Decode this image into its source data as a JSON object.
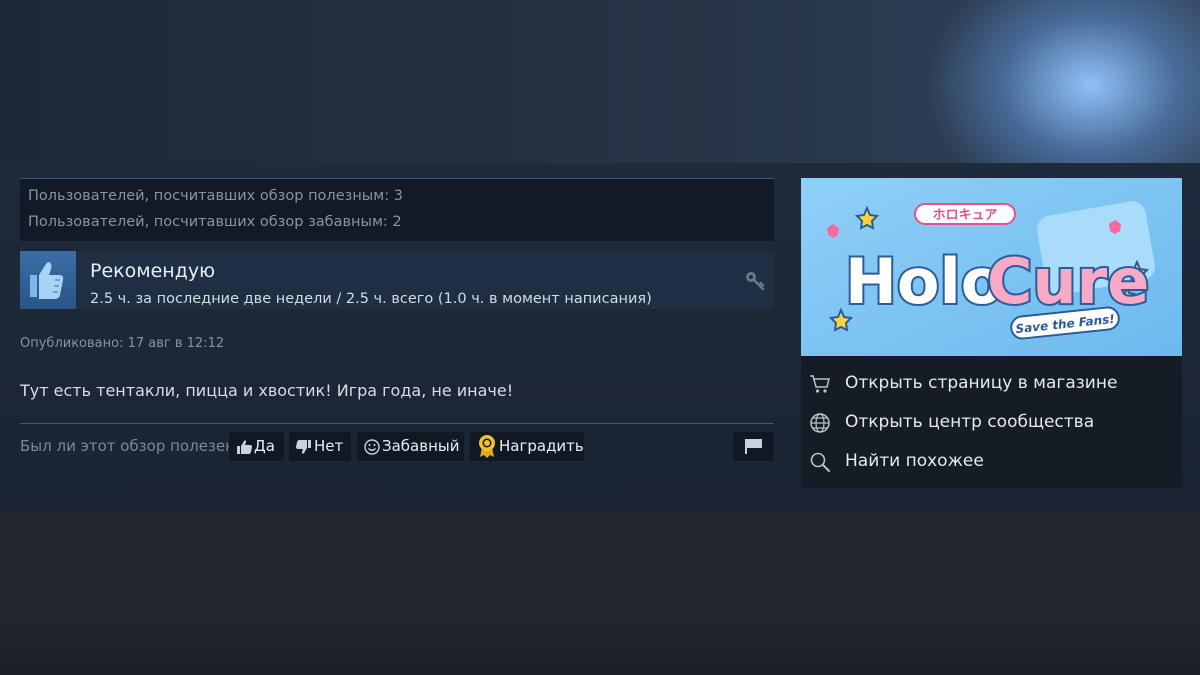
{
  "review": {
    "helpful_count_text": "Пользователей, посчитавших обзор полезным: 3",
    "funny_count_text": "Пользователей, посчитавших обзор забавным: 2",
    "recommendation": "Рекомендую",
    "hours": "2.5 ч. за последние две недели / 2.5 ч. всего (1.0 ч. в момент написания)",
    "posted": "Опубликовано: 17 авг в 12:12",
    "text": "Тут есть тентакли, пицца и хвостик! Игра года, не иначе!",
    "helpful_question": "Был ли этот обзор полезен?",
    "buttons": {
      "yes": "Да",
      "no": "Нет",
      "funny": "Забавный",
      "award": "Наградить"
    }
  },
  "sidebar": {
    "game_logo": {
      "badge": "ホロキュア",
      "title_holo": "Holo",
      "title_cure": "Cure",
      "tagline": "Save the Fans!"
    },
    "links": [
      {
        "label": "Открыть страницу в магазине",
        "icon": "cart-icon"
      },
      {
        "label": "Открыть центр сообщества",
        "icon": "globe-icon"
      },
      {
        "label": "Найти похожее",
        "icon": "search-icon"
      }
    ]
  },
  "colors": {
    "accent_blue": "#3a6fa6",
    "panel_bg": "#1c2737",
    "button_bg": "#101923",
    "award_gold": "#f2c12e"
  }
}
